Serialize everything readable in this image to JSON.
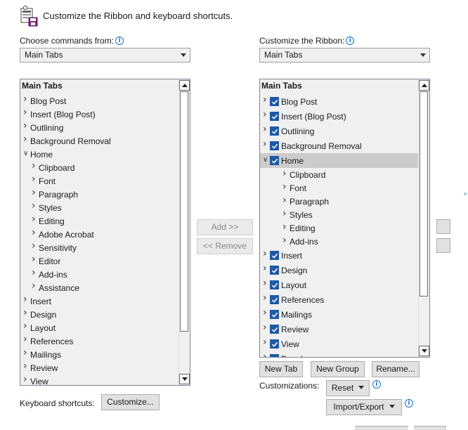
{
  "header": {
    "title": "Customize the Ribbon and keyboard shortcuts.",
    "icon": "ribbon-settings-icon"
  },
  "left": {
    "choose_label": "Choose commands from:",
    "dropdown_value": "Main Tabs",
    "list_header": "Main Tabs",
    "items": [
      {
        "label": "Blog Post",
        "level": 0,
        "expanded": false
      },
      {
        "label": "Insert (Blog Post)",
        "level": 0,
        "expanded": false
      },
      {
        "label": "Outlining",
        "level": 0,
        "expanded": false
      },
      {
        "label": "Background Removal",
        "level": 0,
        "expanded": false
      },
      {
        "label": "Home",
        "level": 0,
        "expanded": true
      },
      {
        "label": "Clipboard",
        "level": 1,
        "expanded": false
      },
      {
        "label": "Font",
        "level": 1,
        "expanded": false
      },
      {
        "label": "Paragraph",
        "level": 1,
        "expanded": false
      },
      {
        "label": "Styles",
        "level": 1,
        "expanded": false
      },
      {
        "label": "Editing",
        "level": 1,
        "expanded": false
      },
      {
        "label": "Adobe Acrobat",
        "level": 1,
        "expanded": false
      },
      {
        "label": "Sensitivity",
        "level": 1,
        "expanded": false
      },
      {
        "label": "Editor",
        "level": 1,
        "expanded": false
      },
      {
        "label": "Add-ins",
        "level": 1,
        "expanded": false
      },
      {
        "label": "Assistance",
        "level": 1,
        "expanded": false
      },
      {
        "label": "Insert",
        "level": 0,
        "expanded": false
      },
      {
        "label": "Design",
        "level": 0,
        "expanded": false
      },
      {
        "label": "Layout",
        "level": 0,
        "expanded": false
      },
      {
        "label": "References",
        "level": 0,
        "expanded": false
      },
      {
        "label": "Mailings",
        "level": 0,
        "expanded": false
      },
      {
        "label": "Review",
        "level": 0,
        "expanded": false
      },
      {
        "label": "View",
        "level": 0,
        "expanded": false
      }
    ]
  },
  "middle": {
    "add_label": "Add >>",
    "remove_label": "<< Remove"
  },
  "right": {
    "customize_label": "Customize the Ribbon:",
    "dropdown_value": "Main Tabs",
    "list_header": "Main Tabs",
    "items": [
      {
        "label": "Blog Post",
        "level": 0,
        "checked": true,
        "expanded": false
      },
      {
        "label": "Insert (Blog Post)",
        "level": 0,
        "checked": true,
        "expanded": false
      },
      {
        "label": "Outlining",
        "level": 0,
        "checked": true,
        "expanded": false
      },
      {
        "label": "Background Removal",
        "level": 0,
        "checked": true,
        "expanded": false
      },
      {
        "label": "Home",
        "level": 0,
        "checked": true,
        "expanded": true,
        "selected": true
      },
      {
        "label": "Clipboard",
        "level": 1
      },
      {
        "label": "Font",
        "level": 1
      },
      {
        "label": "Paragraph",
        "level": 1
      },
      {
        "label": "Styles",
        "level": 1
      },
      {
        "label": "Editing",
        "level": 1
      },
      {
        "label": "Add-ins",
        "level": 1
      },
      {
        "label": "Insert",
        "level": 0,
        "checked": true,
        "expanded": false
      },
      {
        "label": "Design",
        "level": 0,
        "checked": true,
        "expanded": false
      },
      {
        "label": "Layout",
        "level": 0,
        "checked": true,
        "expanded": false
      },
      {
        "label": "References",
        "level": 0,
        "checked": true,
        "expanded": false
      },
      {
        "label": "Mailings",
        "level": 0,
        "checked": true,
        "expanded": false
      },
      {
        "label": "Review",
        "level": 0,
        "checked": true,
        "expanded": false
      },
      {
        "label": "View",
        "level": 0,
        "checked": true,
        "expanded": false
      },
      {
        "label": "Developer",
        "level": 0,
        "checked": true,
        "expanded": false
      }
    ],
    "new_tab_label": "New Tab",
    "new_group_label": "New Group",
    "rename_label": "Rename...",
    "customizations_label": "Customizations:",
    "reset_label": "Reset",
    "import_export_label": "Import/Export"
  },
  "bottom": {
    "keyboard_label": "Keyboard shortcuts:",
    "customize_button": "Customize..."
  },
  "colors": {
    "checkbox": "#1f5aa6",
    "info": "#1a73c9",
    "selection": "#cccccc"
  }
}
